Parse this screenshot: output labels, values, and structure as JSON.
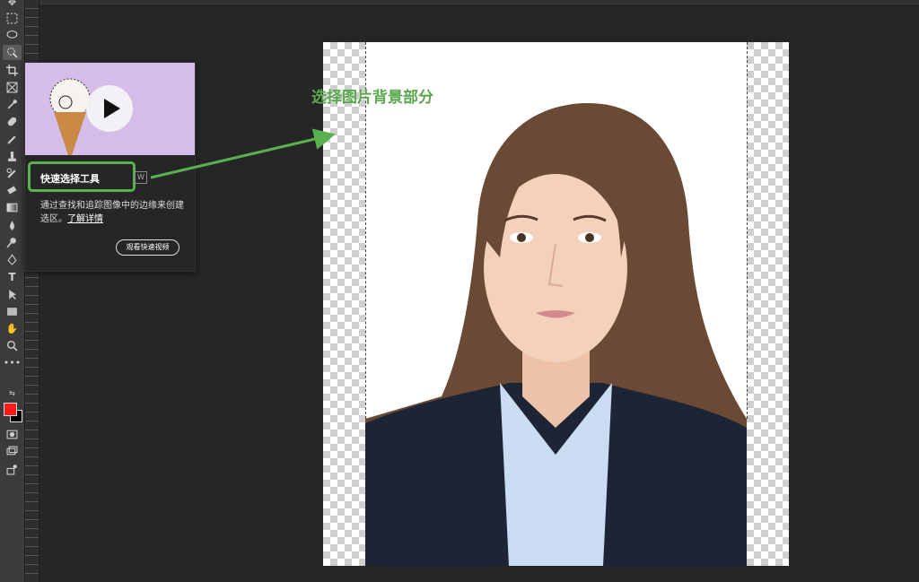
{
  "toolbar": {
    "tools": [
      "move-icon",
      "marquee-icon",
      "lasso-icon",
      "quick-selection-icon",
      "crop-icon",
      "frame-icon",
      "eyedropper-icon",
      "healing-brush-icon",
      "brush-icon",
      "clone-stamp-icon",
      "history-brush-icon",
      "eraser-icon",
      "gradient-icon",
      "blur-icon",
      "dodge-icon",
      "pen-icon",
      "type-icon",
      "path-selection-icon",
      "rectangle-icon",
      "hand-icon",
      "zoom-icon",
      "more-tools-icon"
    ],
    "foreground_color": "#ff1a1a",
    "background_color": "#000000",
    "type_tool_glyph": "T"
  },
  "tooltip": {
    "title": "快速选择工具",
    "shortcut": "W",
    "description": "通过查找和追踪图像中的边缘来创建选区。",
    "learn_more": "了解详情",
    "video_button": "观看快速视频",
    "highlight_color": "#58b04e"
  },
  "annotation": {
    "text": "选择图片背景部分",
    "color": "#5ba84e"
  }
}
